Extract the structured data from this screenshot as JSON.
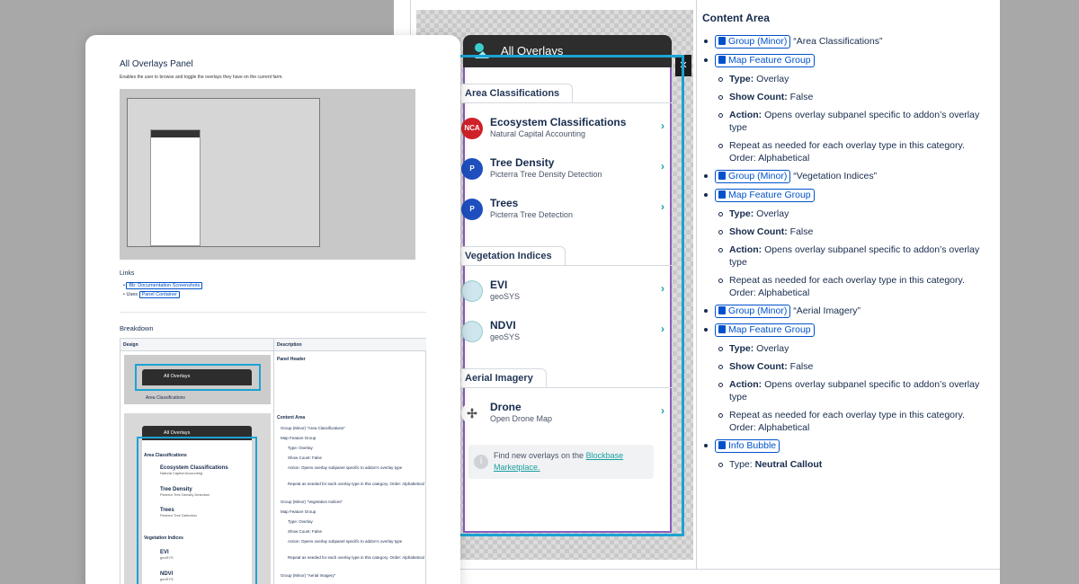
{
  "back_doc": {
    "panel": {
      "header_title": "All Overlays",
      "sections": [
        {
          "label": "Area Classifications",
          "items": [
            {
              "name": "Ecosystem Classifications",
              "sub": "Natural Capital Accounting",
              "icon_text": "NCA",
              "color": "#d0202a"
            },
            {
              "name": "Tree Density",
              "sub": "Picterra Tree Density Detection",
              "icon_text": "P",
              "color": "#1f4fbf"
            },
            {
              "name": "Trees",
              "sub": "Picterra Tree Detection",
              "icon_text": "P",
              "color": "#1f4fbf"
            }
          ]
        },
        {
          "label": "Vegetation Indices",
          "items": [
            {
              "name": "EVI",
              "sub": "geoSYS",
              "icon_text": "",
              "color": "#cfe6ee"
            },
            {
              "name": "NDVI",
              "sub": "geoSYS",
              "icon_text": "",
              "color": "#cfe6ee"
            }
          ]
        },
        {
          "label": "Aerial Imagery",
          "items": [
            {
              "name": "Drone",
              "sub": "Open Drone Map",
              "icon_text": "",
              "color": "#ffffff"
            }
          ]
        }
      ],
      "find_text": "Find new overlays on the",
      "find_link": "Blockbase Marketplace."
    },
    "content": {
      "title": "Content Area",
      "group1_chip": "Group (Minor)",
      "group1_text": "“Area Classifications”",
      "map1_chip": "Map Feature Group",
      "type_label": "Type:",
      "type_val": "Overlay",
      "show_label": "Show Count:",
      "show_val": "False",
      "action_label": "Action:",
      "action_val": "Opens overlay subpanel specific to addon’s overlay type",
      "repeat_text": "Repeat as needed for each overlay type in this category. Order: Alphabetical",
      "group2_chip": "Group (Minor)",
      "group2_text": "“Vegetation Indices”",
      "map2_chip": "Map Feature Group",
      "group3_chip": "Group (Minor)",
      "group3_text": "“Aerial Imagery”",
      "map3_chip": "Map Feature Group",
      "bubble_chip": "Info Bubble",
      "bubble_type_label": "Type:",
      "bubble_type_val": "Neutral Callout"
    }
  },
  "front_doc": {
    "title": "All Overlays Panel",
    "subtitle": "Enables the user to browse and toggle the overlays they have on the current farm.",
    "links_title": "Links",
    "link1": "Bb: Documentation Screenshots",
    "link2_prefix": "Uses",
    "link2": "Panel Container",
    "breakdown_title": "Breakdown",
    "col_design": "Design",
    "col_description": "Description",
    "row1_desc": "Panel Header",
    "row2_desc": "Content Area",
    "mini_header": "All Overlays",
    "mini_area": "Area Classifications",
    "mini_items": [
      {
        "name": "Ecosystem Classifications",
        "sub": "Natural Capital Accounting"
      },
      {
        "name": "Tree Density",
        "sub": "Picterra Tree Density Detection"
      },
      {
        "name": "Trees",
        "sub": "Picterra Tree Detection"
      }
    ],
    "mini_veg": "Vegetation Indices",
    "mini_veg_items": [
      {
        "name": "EVI",
        "sub": "geoSYS"
      },
      {
        "name": "NDVI",
        "sub": "geoSYS"
      }
    ],
    "desc_lines": [
      "Group (Minor) “Area Classifications”",
      "Map Feature Group",
      "Type: Overlay",
      "Show Count: False",
      "Action: Opens overlay subpanel specific to addon's overlay type",
      "Repeat as needed for each overlay type in this category. Order: Alphabetical",
      "Group (Minor) “Vegetation Indices”",
      "Map Feature Group",
      "Type: Overlay",
      "Show Count: False",
      "Action: Opens overlay subpanel specific to addon's overlay type",
      "Repeat as needed for each overlay type in this category. Order: Alphabetical",
      "Group (Minor) “Aerial Imagery”"
    ]
  }
}
